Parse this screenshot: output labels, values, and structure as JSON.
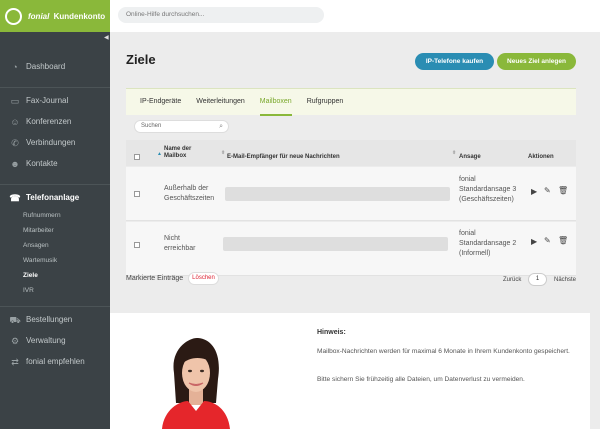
{
  "app": {
    "logo_brand": "fonial",
    "logo_suffix": "Kundenkonto"
  },
  "search": {
    "placeholder": "Online-Hilfe durchsuchen..."
  },
  "sidebar": {
    "items": [
      {
        "label": "Dashboard",
        "icon": "dashboard-icon"
      },
      {
        "label": "Fax-Journal",
        "icon": "fax-icon"
      },
      {
        "label": "Konferenzen",
        "icon": "conference-icon"
      },
      {
        "label": "Verbindungen",
        "icon": "phone-icon"
      },
      {
        "label": "Kontakte",
        "icon": "contacts-icon"
      },
      {
        "label": "Telefonanlage",
        "icon": "phone-system-icon",
        "active": true
      },
      {
        "label": "Bestellungen",
        "icon": "cart-icon"
      },
      {
        "label": "Verwaltung",
        "icon": "settings-icon"
      },
      {
        "label": "fonial empfehlen",
        "icon": "share-icon"
      }
    ],
    "subitems": [
      {
        "label": "Rufnummern"
      },
      {
        "label": "Mitarbeiter"
      },
      {
        "label": "Ansagen"
      },
      {
        "label": "Wartemusik"
      },
      {
        "label": "Ziele",
        "active": true
      },
      {
        "label": "IVR"
      }
    ]
  },
  "page": {
    "title": "Ziele"
  },
  "buttons": {
    "buy_phones": "IP-Telefone kaufen",
    "new_target": "Neues Ziel anlegen"
  },
  "tabs": [
    {
      "label": "IP-Endgeräte"
    },
    {
      "label": "Weiterleitungen"
    },
    {
      "label": "Mailboxen",
      "active": true
    },
    {
      "label": "Rufgruppen"
    }
  ],
  "table": {
    "search_placeholder": "Suchen",
    "headers": {
      "name": "Name der Mailbox",
      "email": "E-Mail-Empfänger für neue Nachrichten",
      "announcement": "Ansage",
      "actions": "Aktionen"
    },
    "rows": [
      {
        "name": "Außerhalb der Geschäftszeiten",
        "announcement": "fonial Standardansage 3 (Geschäftszeiten)"
      },
      {
        "name": "Nicht erreichbar",
        "announcement": "fonial Standardansage 2 (Informell)"
      }
    ]
  },
  "bulk": {
    "label": "Markierte Einträge",
    "delete": "Löschen"
  },
  "pager": {
    "back": "Zurück",
    "page": "1",
    "next": "Nächste"
  },
  "hint": {
    "title": "Hinweis:",
    "p1": "Mailbox-Nachrichten werden für maximal 6 Monate in Ihrem Kundenkonto gespeichert.",
    "p2": "Bitte sichern Sie frühzeitig alle Dateien, um Datenverlust zu vermeiden."
  },
  "colors": {
    "brand_green": "#8ab83a",
    "brand_blue": "#2a8db3",
    "sidebar": "#3b4246"
  }
}
